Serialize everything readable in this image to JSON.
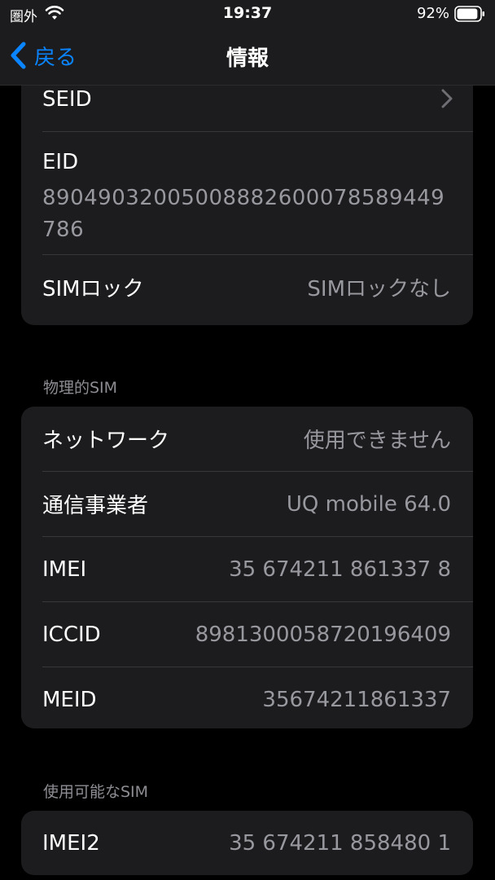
{
  "status_bar": {
    "carrier": "圏外",
    "time": "19:37",
    "battery_percent": "92%",
    "battery_level": 0.92
  },
  "nav": {
    "back_label": "戻る",
    "title": "情報"
  },
  "group1": {
    "seid_label": "SEID",
    "eid_label": "EID",
    "eid_value": "89049032005008882600078589449786",
    "sim_lock_label": "SIMロック",
    "sim_lock_value": "SIMロックなし"
  },
  "physical_sim": {
    "header": "物理的SIM",
    "rows": [
      {
        "label": "ネットワーク",
        "value": "使用できません"
      },
      {
        "label": "通信事業者",
        "value": "UQ mobile 64.0"
      },
      {
        "label": "IMEI",
        "value": "35 674211 861337 8"
      },
      {
        "label": "ICCID",
        "value": "8981300058720196409"
      },
      {
        "label": "MEID",
        "value": "35674211861337"
      }
    ]
  },
  "available_sim": {
    "header": "使用可能なSIM",
    "rows": [
      {
        "label": "IMEI2",
        "value": "35 674211 858480 1"
      }
    ]
  },
  "colors": {
    "accent": "#0a84ff",
    "background": "#000000",
    "cell": "#1c1c1e",
    "secondary_text": "#98989f"
  }
}
